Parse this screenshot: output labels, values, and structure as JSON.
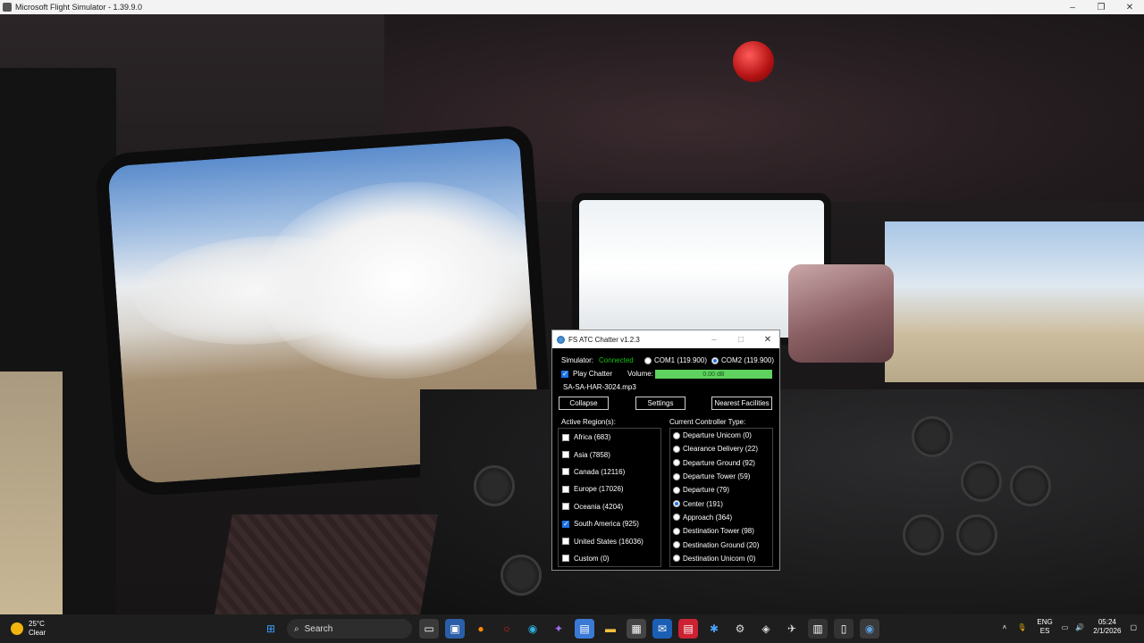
{
  "window": {
    "title": "Microsoft Flight Simulator - 1.39.9.0"
  },
  "dialog": {
    "title": "FS ATC Chatter v1.2.3",
    "simulator_label": "Simulator:",
    "simulator_status": "Connected",
    "com1_label": "COM1 (119.900)",
    "com2_label": "COM2 (119.900)",
    "play_chatter_label": "Play Chatter",
    "volume_label": "Volume:",
    "volume_value": "0.00 dB",
    "volume_level": 1.0,
    "current_file": "SA-SA-HAR-3024.mp3",
    "buttons": {
      "collapse": "Collapse",
      "settings": "Settings",
      "nearest": "Nearest Facilities"
    },
    "regions_header": "Active Region(s):",
    "regions": [
      {
        "label": "Africa (683)",
        "checked": false
      },
      {
        "label": "Asia (7858)",
        "checked": false
      },
      {
        "label": "Canada (12116)",
        "checked": false
      },
      {
        "label": "Europe (17026)",
        "checked": false
      },
      {
        "label": "Oceania (4204)",
        "checked": false
      },
      {
        "label": "South America (925)",
        "checked": true
      },
      {
        "label": "United States (16036)",
        "checked": false
      },
      {
        "label": "Custom (0)",
        "checked": false
      }
    ],
    "controllers_header": "Current Controller Type:",
    "controllers": [
      {
        "label": "Departure Unicom (0)",
        "selected": false
      },
      {
        "label": "Clearance Delivery (22)",
        "selected": false
      },
      {
        "label": "Departure Ground (92)",
        "selected": false
      },
      {
        "label": "Departure Tower (59)",
        "selected": false
      },
      {
        "label": "Departure (79)",
        "selected": false
      },
      {
        "label": "Center (191)",
        "selected": true
      },
      {
        "label": "Approach (364)",
        "selected": false
      },
      {
        "label": "Destination Tower (98)",
        "selected": false
      },
      {
        "label": "Destination Ground (20)",
        "selected": false
      },
      {
        "label": "Destination Unicom (0)",
        "selected": false
      }
    ]
  },
  "taskbar": {
    "weather_temp": "25°C",
    "weather_desc": "Clear",
    "search_label": "Search",
    "lang_top": "ENG",
    "lang_bottom": "ES",
    "time": "05:24",
    "date": "2/1/2026"
  }
}
